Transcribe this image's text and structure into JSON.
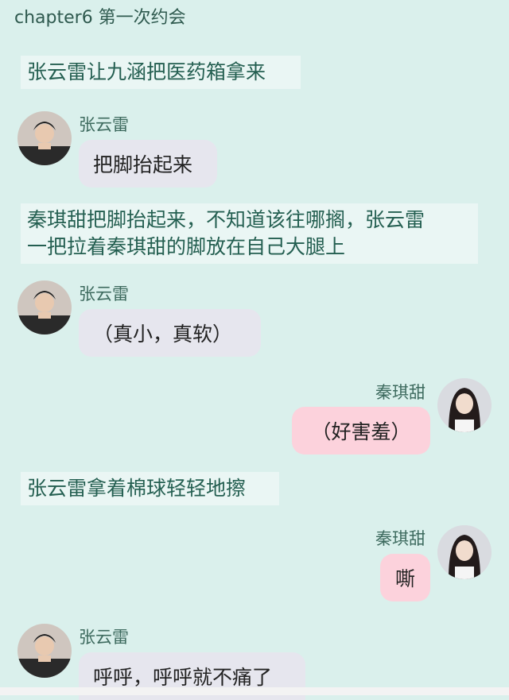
{
  "header": {
    "title": "chapter6 第一次约会"
  },
  "messages": [
    {
      "kind": "narration",
      "text": "张云雷让九涵把医药箱拿来"
    },
    {
      "kind": "left",
      "sender": "张云雷",
      "text": "把脚抬起来",
      "avatar_icon": "male-avatar-icon"
    },
    {
      "kind": "narration",
      "lines": [
        "秦琪甜把脚抬起来，不知道该往哪搁，张云雷",
        "一把拉着秦琪甜的脚放在自己大腿上"
      ]
    },
    {
      "kind": "left",
      "sender": "张云雷",
      "text": "（真小，真软）",
      "avatar_icon": "male-avatar-icon"
    },
    {
      "kind": "right",
      "sender": "秦琪甜",
      "text": "（好害羞）",
      "avatar_icon": "female-avatar-icon"
    },
    {
      "kind": "narration",
      "text": "张云雷拿着棉球轻轻地擦"
    },
    {
      "kind": "right",
      "sender": "秦琪甜",
      "text": "嘶",
      "avatar_icon": "female-avatar-icon"
    },
    {
      "kind": "left",
      "sender": "张云雷",
      "text": "呼呼，呼呼就不痛了",
      "avatar_icon": "male-avatar-icon"
    }
  ],
  "colors": {
    "background": "#daf0ec",
    "narration_bg": "#eaf6f4",
    "narration_text": "#245f51",
    "left_bubble": "#e6e6ee",
    "right_bubble": "#fcd2dc"
  }
}
